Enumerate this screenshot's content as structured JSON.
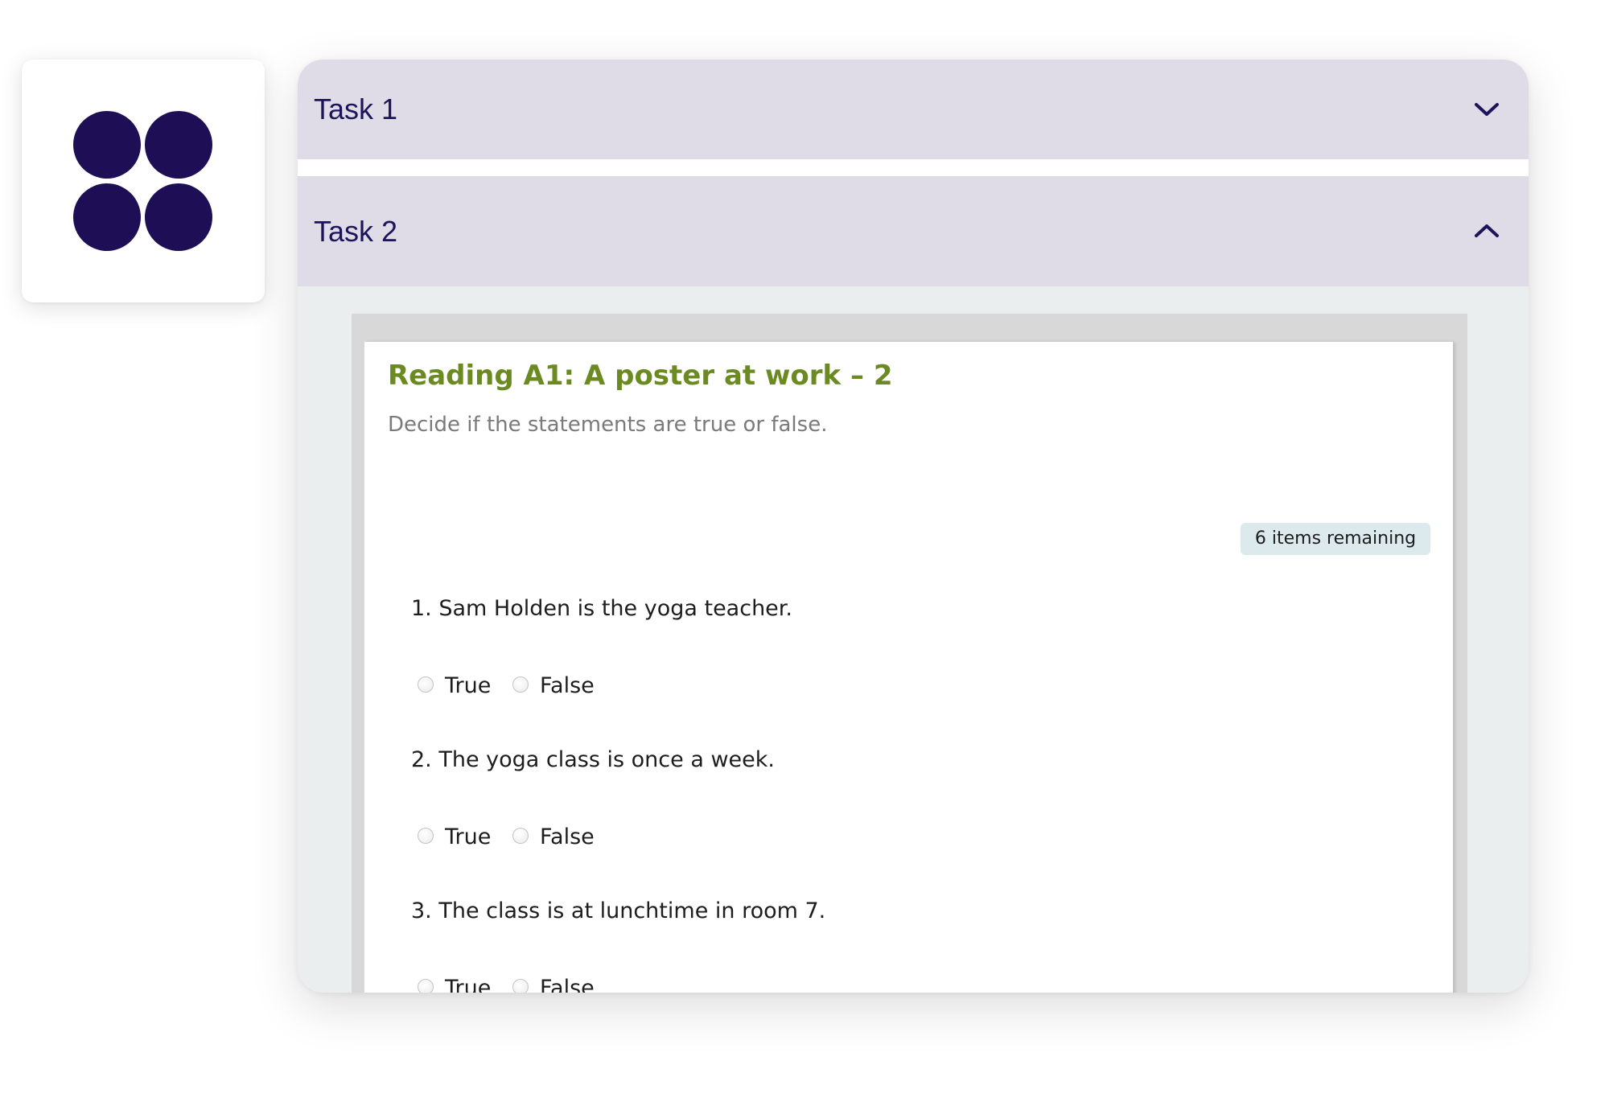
{
  "brand": {
    "logo_color": "#1e0e55"
  },
  "accordion": {
    "tasks": [
      {
        "label": "Task 1",
        "state": "collapsed",
        "icon": "chevron-down-icon"
      },
      {
        "label": "Task 2",
        "state": "expanded",
        "icon": "chevron-up-icon"
      }
    ],
    "header_color": "#dfdce8",
    "title_color": "#1c1559"
  },
  "activity": {
    "title": "Reading A1: A poster at work – 2",
    "instruction": "Decide if the statements are true or false.",
    "title_color": "#6b8a22",
    "remaining": "6 items remaining",
    "questions": [
      {
        "text": "1. Sam Holden is the yoga teacher.",
        "options": [
          "True",
          "False"
        ]
      },
      {
        "text": "2. The yoga class is once a week.",
        "options": [
          "True",
          "False"
        ]
      },
      {
        "text": "3. The class is at lunchtime in room 7.",
        "options": [
          "True",
          "False"
        ]
      }
    ]
  }
}
